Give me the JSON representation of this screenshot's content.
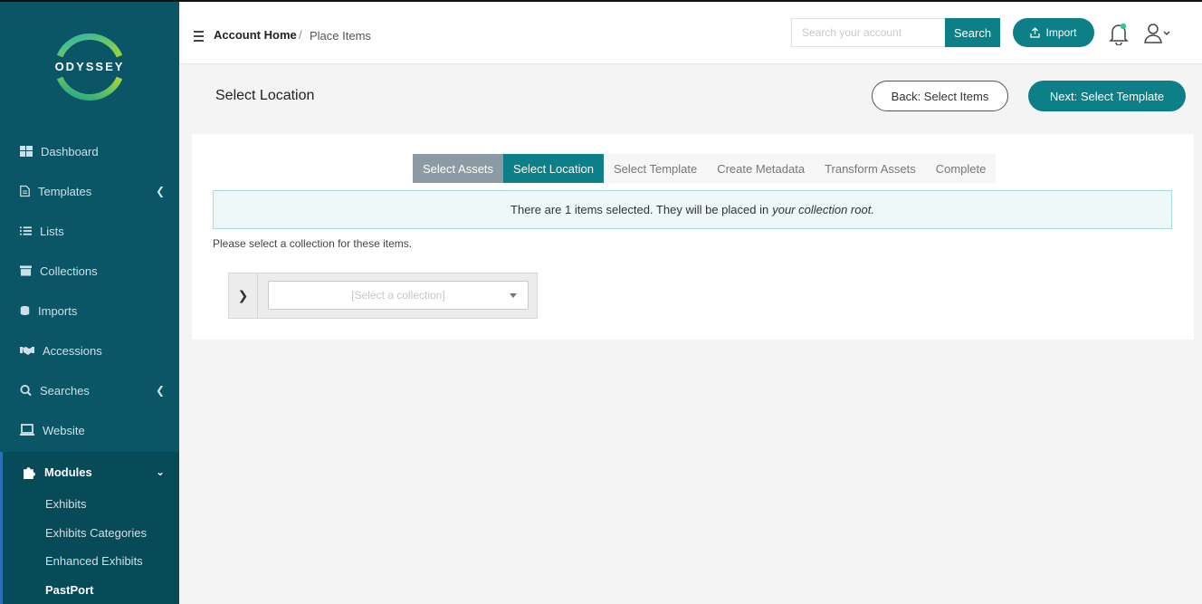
{
  "app": {
    "logo_text": "ODYSSEY"
  },
  "sidebar": {
    "items": [
      {
        "label": "Dashboard",
        "icon": "dashboard-icon"
      },
      {
        "label": "Templates",
        "icon": "document-icon"
      },
      {
        "label": "Lists",
        "icon": "list-icon"
      },
      {
        "label": "Collections",
        "icon": "archive-icon"
      },
      {
        "label": "Imports",
        "icon": "database-icon"
      },
      {
        "label": "Accessions",
        "icon": "handshake-icon"
      },
      {
        "label": "Searches",
        "icon": "search-icon"
      },
      {
        "label": "Website",
        "icon": "laptop-icon"
      },
      {
        "label": "Modules",
        "icon": "puzzle-icon"
      }
    ],
    "sub_items": [
      {
        "label": "Exhibits"
      },
      {
        "label": "Exhibits Categories"
      },
      {
        "label": "Enhanced Exhibits"
      },
      {
        "label": "PastPort"
      }
    ]
  },
  "header": {
    "breadcrumb_home": "Account Home",
    "breadcrumb_sep": "/",
    "breadcrumb_current": "Place Items",
    "search_placeholder": "Search your account",
    "search_label": "Search",
    "import_label": "Import"
  },
  "page": {
    "title": "Select Location",
    "back_label": "Back: Select Items",
    "next_label": "Next: Select Template"
  },
  "wizard": {
    "steps": [
      {
        "label": "Select Assets",
        "state": "done"
      },
      {
        "label": "Select Location",
        "state": "current"
      },
      {
        "label": "Select Template",
        "state": "todo"
      },
      {
        "label": "Create Metadata",
        "state": "todo"
      },
      {
        "label": "Transform Assets",
        "state": "todo"
      },
      {
        "label": "Complete",
        "state": "todo"
      }
    ],
    "info_text": "There are 1 items selected. They will be placed in",
    "info_emphasis": "your collection root.",
    "hint": "Please select a collection for these items.",
    "select_placeholder": "[Select a collection]"
  },
  "colors": {
    "sidebar": "#0a5566",
    "accent": "#0d7f87",
    "done_step": "#8c9aa3"
  }
}
